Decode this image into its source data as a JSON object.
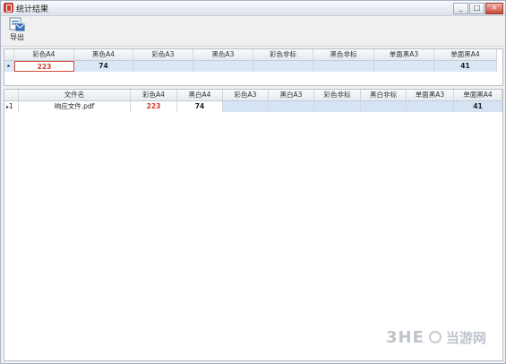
{
  "window": {
    "title": "统计结果",
    "controls": [
      "_",
      "□",
      "×"
    ]
  },
  "toolbar": {
    "export_label": "导出"
  },
  "summary": {
    "headers": [
      "彩色A4",
      "黑色A4",
      "彩色A3",
      "黑色A3",
      "彩色非标",
      "黑色非标",
      "单面黑A3",
      "单面黑A4"
    ],
    "row_marker": "▸",
    "row": [
      "223",
      "74",
      "",
      "",
      "",
      "",
      "",
      "41"
    ]
  },
  "detail": {
    "headers": [
      "文件名",
      "彩色A4",
      "黑白A4",
      "彩色A3",
      "黑白A3",
      "彩色非标",
      "黑白非标",
      "单面黑A3",
      "单面黑A4"
    ],
    "row_marker": "▸",
    "row_index": "1",
    "row": [
      "响应文件.pdf",
      "223",
      "74",
      "",
      "",
      "",
      "",
      "",
      "41"
    ]
  },
  "watermark": {
    "text_en": "3HE",
    "text_cn": "当游网"
  },
  "colors": {
    "value_red": "#d0392c",
    "selection_blue": "#dbe7f7",
    "focus_border": "#d04a3a"
  }
}
